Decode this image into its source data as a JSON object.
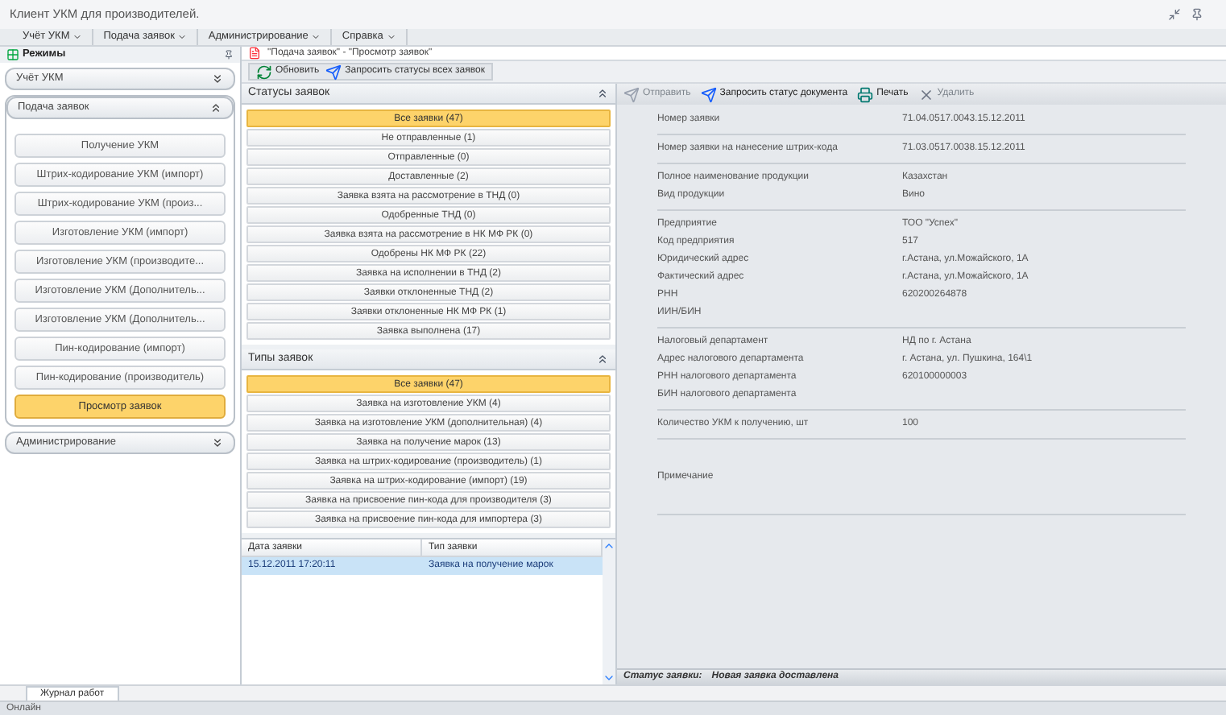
{
  "window": {
    "title": "Клиент УКМ для производителей."
  },
  "menu": [
    {
      "label": "Учёт УКМ"
    },
    {
      "label": "Подача заявок"
    },
    {
      "label": "Администрирование"
    },
    {
      "label": "Справка"
    }
  ],
  "sidebar": {
    "title": "Режимы",
    "groups": [
      {
        "label": "Учёт УКМ",
        "expanded": false
      },
      {
        "label": "Подача заявок",
        "expanded": true,
        "items": [
          {
            "label": "Получение УКМ",
            "selected": false
          },
          {
            "label": "Штрих-кодирование УКМ (импорт)",
            "selected": false
          },
          {
            "label": "Штрих-кодирование УКМ (произ...",
            "selected": false
          },
          {
            "label": "Изготовление УКМ (импорт)",
            "selected": false
          },
          {
            "label": "Изготовление УКМ (производите...",
            "selected": false
          },
          {
            "label": "Изготовление УКМ (Дополнитель...",
            "selected": false
          },
          {
            "label": "Изготовление УКМ (Дополнитель...",
            "selected": false
          },
          {
            "label": "Пин-кодирование (импорт)",
            "selected": false
          },
          {
            "label": "Пин-кодирование (производитель)",
            "selected": false
          },
          {
            "label": "Просмотр заявок",
            "selected": true
          }
        ]
      },
      {
        "label": "Администрирование",
        "expanded": false
      }
    ]
  },
  "document_tab": {
    "title": "\"Подача заявок\" - \"Просмотр заявок\""
  },
  "toolbar": [
    {
      "label": "Обновить",
      "kind": "refresh"
    },
    {
      "label": "Запросить статусы всех заявок",
      "kind": "request"
    }
  ],
  "status_filter": {
    "title": "Статусы заявок",
    "items": [
      {
        "label": "Все заявки (47)",
        "selected": true
      },
      {
        "label": "Не отправленные (1)",
        "selected": false
      },
      {
        "label": "Отправленные (0)",
        "selected": false
      },
      {
        "label": "Доставленные (2)",
        "selected": false
      },
      {
        "label": "Заявка взята на рассмотрение в ТНД (0)",
        "selected": false
      },
      {
        "label": "Одобренные ТНД (0)",
        "selected": false
      },
      {
        "label": "Заявка взята на рассмотрение в НК МФ РК (0)",
        "selected": false
      },
      {
        "label": "Одобрены НК МФ РК (22)",
        "selected": false
      },
      {
        "label": "Заявка на исполнении в ТНД (2)",
        "selected": false
      },
      {
        "label": "Заявки отклоненные ТНД (2)",
        "selected": false
      },
      {
        "label": "Заявки отклоненные НК МФ РК (1)",
        "selected": false
      },
      {
        "label": "Заявка выполнена (17)",
        "selected": false
      }
    ]
  },
  "type_filter": {
    "title": "Типы заявок",
    "items": [
      {
        "label": "Все заявки (47)",
        "selected": true
      },
      {
        "label": "Заявка на изготовление УКМ (4)",
        "selected": false
      },
      {
        "label": "Заявка на изготовление УКМ (дополнительная) (4)",
        "selected": false
      },
      {
        "label": "Заявка на получение марок (13)",
        "selected": false
      },
      {
        "label": "Заявка на штрих-кодирование (производитель) (1)",
        "selected": false
      },
      {
        "label": "Заявка на штрих-кодирование (импорт) (19)",
        "selected": false
      },
      {
        "label": "Заявка на присвоение пин-кода для производителя (3)",
        "selected": false
      },
      {
        "label": "Заявка на присвоение пин-кода для импортера (3)",
        "selected": false
      }
    ]
  },
  "grid": {
    "columns": [
      "Дата заявки",
      "Тип заявки"
    ],
    "rows": [
      {
        "cells": [
          "15.12.2011 17:20:11",
          "Заявка на получение марок"
        ],
        "selected": true
      }
    ]
  },
  "detail_toolbar": [
    {
      "label": "Отправить",
      "kind": "send",
      "disabled": true
    },
    {
      "label": "Запросить статус документа",
      "kind": "request",
      "disabled": false
    },
    {
      "label": "Печать",
      "kind": "print",
      "disabled": false
    },
    {
      "label": "Удалить",
      "kind": "delete",
      "disabled": true
    }
  ],
  "details": [
    [
      {
        "label": "Номер заявки",
        "value": "71.04.0517.0043.15.12.2011"
      }
    ],
    [
      {
        "label": "Номер заявки на нанесение штрих-кода",
        "value": "71.03.0517.0038.15.12.2011"
      }
    ],
    [
      {
        "label": "Полное наименование продукции",
        "value": "Казахстан"
      },
      {
        "label": "Вид продукции",
        "value": "Вино"
      }
    ],
    [
      {
        "label": "Предприятие",
        "value": "ТОО \"Успех\""
      },
      {
        "label": "Код предприятия",
        "value": "517"
      },
      {
        "label": "Юридический адрес",
        "value": "г.Астана, ул.Можайского, 1А"
      },
      {
        "label": "Фактический адрес",
        "value": "г.Астана, ул.Можайского, 1А"
      },
      {
        "label": "РНН",
        "value": "620200264878"
      },
      {
        "label": "ИИН/БИН"
      }
    ],
    [
      {
        "label": "Налоговый департамент",
        "value": "НД по г. Астана"
      },
      {
        "label": "Адрес налогового департамента",
        "value": "г. Астана, ул. Пушкина, 164\\1"
      },
      {
        "label": "РНН налогового департамента",
        "value": "620100000003"
      },
      {
        "label": "БИН налогового департамента"
      }
    ],
    [
      {
        "label": "Количество УКМ к получению, шт",
        "value": "100"
      }
    ],
    [
      {
        "label": "Примечание",
        "kind": "note"
      }
    ]
  ],
  "request_status": {
    "label": "Статус заявки:",
    "value": "Новая заявка доставлена"
  },
  "bottom_tabs": [
    {
      "label": "Журнал работ"
    }
  ],
  "status_bar": {
    "text": "Онлайн"
  }
}
